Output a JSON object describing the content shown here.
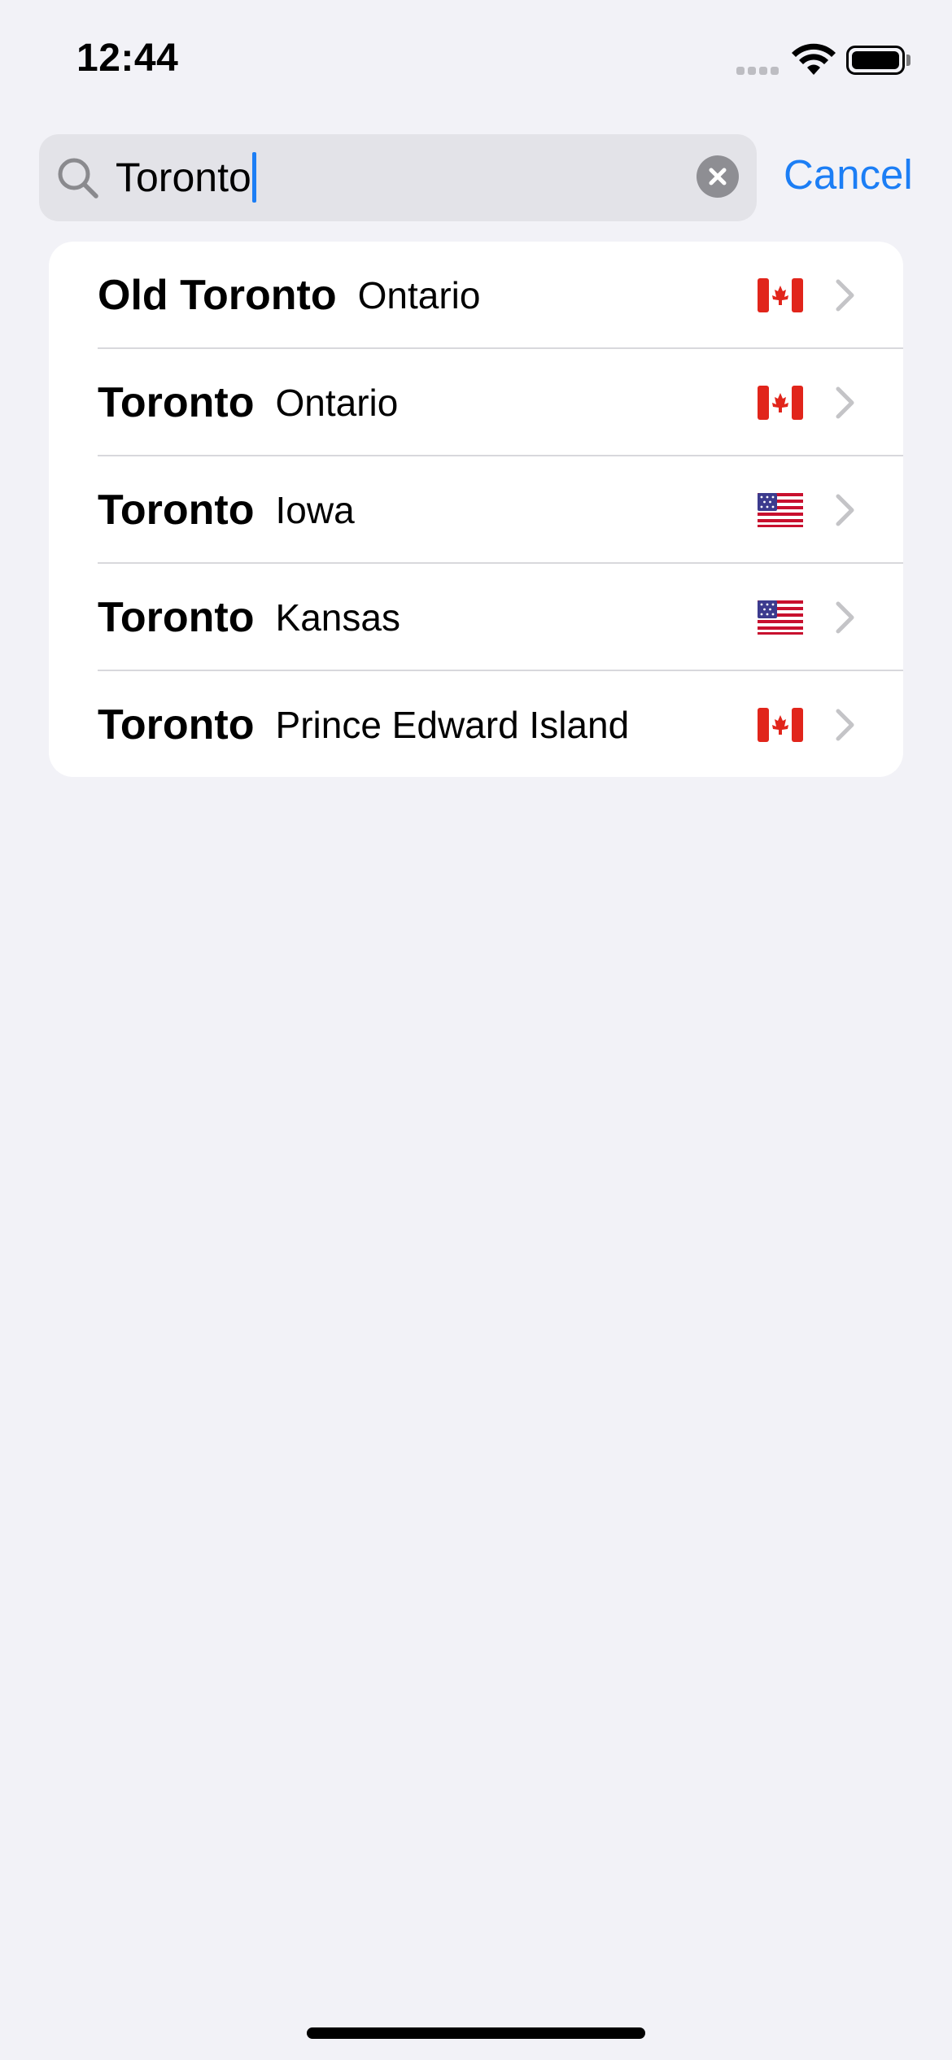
{
  "status_bar": {
    "time": "12:44",
    "signal_icon": "cellular-signal-icon",
    "wifi_icon": "wifi-icon",
    "battery_icon": "battery-icon",
    "battery_level": 1.0
  },
  "search": {
    "value": "Toronto",
    "search_icon": "search-icon",
    "clear_icon": "clear-circle-icon",
    "cancel_label": "Cancel"
  },
  "results": [
    {
      "city": "Old Toronto",
      "region": "Ontario",
      "flag": "canada-flag-icon"
    },
    {
      "city": "Toronto",
      "region": "Ontario",
      "flag": "canada-flag-icon"
    },
    {
      "city": "Toronto",
      "region": "Iowa",
      "flag": "usa-flag-icon"
    },
    {
      "city": "Toronto",
      "region": "Kansas",
      "flag": "usa-flag-icon"
    },
    {
      "city": "Toronto",
      "region": "Prince Edward Island",
      "flag": "canada-flag-icon"
    }
  ],
  "colors": {
    "accent": "#1C7EF5",
    "background": "#F2F2F7",
    "card": "#FFFFFF",
    "search_field": "#E3E3E8"
  }
}
